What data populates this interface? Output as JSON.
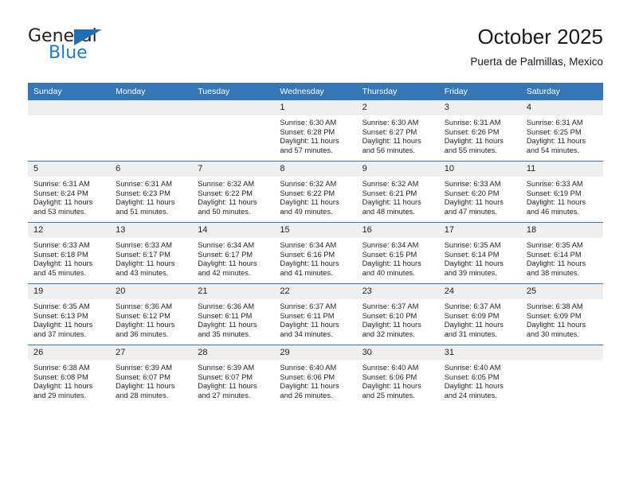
{
  "brand": {
    "name_top": "General",
    "name_bottom": "Blue",
    "accent_color": "#1f7ac4",
    "triangle_color": "#1f6fb5"
  },
  "header": {
    "title": "October 2025",
    "subtitle": "Puerta de Palmillas, Mexico"
  },
  "theme": {
    "header_bg": "#3576b5",
    "header_text": "#ffffff",
    "daynum_bg": "#efefef",
    "row_divider": "#3576b5",
    "body_text": "#231f20"
  },
  "weekdays": [
    "Sunday",
    "Monday",
    "Tuesday",
    "Wednesday",
    "Thursday",
    "Friday",
    "Saturday"
  ],
  "weeks": [
    [
      {
        "day": "",
        "empty": true,
        "sunrise": "",
        "sunset": "",
        "daylight1": "",
        "daylight2": ""
      },
      {
        "day": "",
        "empty": true,
        "sunrise": "",
        "sunset": "",
        "daylight1": "",
        "daylight2": ""
      },
      {
        "day": "",
        "empty": true,
        "sunrise": "",
        "sunset": "",
        "daylight1": "",
        "daylight2": ""
      },
      {
        "day": "1",
        "sunrise": "Sunrise: 6:30 AM",
        "sunset": "Sunset: 6:28 PM",
        "daylight1": "Daylight: 11 hours",
        "daylight2": "and 57 minutes."
      },
      {
        "day": "2",
        "sunrise": "Sunrise: 6:30 AM",
        "sunset": "Sunset: 6:27 PM",
        "daylight1": "Daylight: 11 hours",
        "daylight2": "and 56 minutes."
      },
      {
        "day": "3",
        "sunrise": "Sunrise: 6:31 AM",
        "sunset": "Sunset: 6:26 PM",
        "daylight1": "Daylight: 11 hours",
        "daylight2": "and 55 minutes."
      },
      {
        "day": "4",
        "sunrise": "Sunrise: 6:31 AM",
        "sunset": "Sunset: 6:25 PM",
        "daylight1": "Daylight: 11 hours",
        "daylight2": "and 54 minutes."
      }
    ],
    [
      {
        "day": "5",
        "sunrise": "Sunrise: 6:31 AM",
        "sunset": "Sunset: 6:24 PM",
        "daylight1": "Daylight: 11 hours",
        "daylight2": "and 53 minutes."
      },
      {
        "day": "6",
        "sunrise": "Sunrise: 6:31 AM",
        "sunset": "Sunset: 6:23 PM",
        "daylight1": "Daylight: 11 hours",
        "daylight2": "and 51 minutes."
      },
      {
        "day": "7",
        "sunrise": "Sunrise: 6:32 AM",
        "sunset": "Sunset: 6:22 PM",
        "daylight1": "Daylight: 11 hours",
        "daylight2": "and 50 minutes."
      },
      {
        "day": "8",
        "sunrise": "Sunrise: 6:32 AM",
        "sunset": "Sunset: 6:22 PM",
        "daylight1": "Daylight: 11 hours",
        "daylight2": "and 49 minutes."
      },
      {
        "day": "9",
        "sunrise": "Sunrise: 6:32 AM",
        "sunset": "Sunset: 6:21 PM",
        "daylight1": "Daylight: 11 hours",
        "daylight2": "and 48 minutes."
      },
      {
        "day": "10",
        "sunrise": "Sunrise: 6:33 AM",
        "sunset": "Sunset: 6:20 PM",
        "daylight1": "Daylight: 11 hours",
        "daylight2": "and 47 minutes."
      },
      {
        "day": "11",
        "sunrise": "Sunrise: 6:33 AM",
        "sunset": "Sunset: 6:19 PM",
        "daylight1": "Daylight: 11 hours",
        "daylight2": "and 46 minutes."
      }
    ],
    [
      {
        "day": "12",
        "sunrise": "Sunrise: 6:33 AM",
        "sunset": "Sunset: 6:18 PM",
        "daylight1": "Daylight: 11 hours",
        "daylight2": "and 45 minutes."
      },
      {
        "day": "13",
        "sunrise": "Sunrise: 6:33 AM",
        "sunset": "Sunset: 6:17 PM",
        "daylight1": "Daylight: 11 hours",
        "daylight2": "and 43 minutes."
      },
      {
        "day": "14",
        "sunrise": "Sunrise: 6:34 AM",
        "sunset": "Sunset: 6:17 PM",
        "daylight1": "Daylight: 11 hours",
        "daylight2": "and 42 minutes."
      },
      {
        "day": "15",
        "sunrise": "Sunrise: 6:34 AM",
        "sunset": "Sunset: 6:16 PM",
        "daylight1": "Daylight: 11 hours",
        "daylight2": "and 41 minutes."
      },
      {
        "day": "16",
        "sunrise": "Sunrise: 6:34 AM",
        "sunset": "Sunset: 6:15 PM",
        "daylight1": "Daylight: 11 hours",
        "daylight2": "and 40 minutes."
      },
      {
        "day": "17",
        "sunrise": "Sunrise: 6:35 AM",
        "sunset": "Sunset: 6:14 PM",
        "daylight1": "Daylight: 11 hours",
        "daylight2": "and 39 minutes."
      },
      {
        "day": "18",
        "sunrise": "Sunrise: 6:35 AM",
        "sunset": "Sunset: 6:14 PM",
        "daylight1": "Daylight: 11 hours",
        "daylight2": "and 38 minutes."
      }
    ],
    [
      {
        "day": "19",
        "sunrise": "Sunrise: 6:35 AM",
        "sunset": "Sunset: 6:13 PM",
        "daylight1": "Daylight: 11 hours",
        "daylight2": "and 37 minutes."
      },
      {
        "day": "20",
        "sunrise": "Sunrise: 6:36 AM",
        "sunset": "Sunset: 6:12 PM",
        "daylight1": "Daylight: 11 hours",
        "daylight2": "and 36 minutes."
      },
      {
        "day": "21",
        "sunrise": "Sunrise: 6:36 AM",
        "sunset": "Sunset: 6:11 PM",
        "daylight1": "Daylight: 11 hours",
        "daylight2": "and 35 minutes."
      },
      {
        "day": "22",
        "sunrise": "Sunrise: 6:37 AM",
        "sunset": "Sunset: 6:11 PM",
        "daylight1": "Daylight: 11 hours",
        "daylight2": "and 34 minutes."
      },
      {
        "day": "23",
        "sunrise": "Sunrise: 6:37 AM",
        "sunset": "Sunset: 6:10 PM",
        "daylight1": "Daylight: 11 hours",
        "daylight2": "and 32 minutes."
      },
      {
        "day": "24",
        "sunrise": "Sunrise: 6:37 AM",
        "sunset": "Sunset: 6:09 PM",
        "daylight1": "Daylight: 11 hours",
        "daylight2": "and 31 minutes."
      },
      {
        "day": "25",
        "sunrise": "Sunrise: 6:38 AM",
        "sunset": "Sunset: 6:09 PM",
        "daylight1": "Daylight: 11 hours",
        "daylight2": "and 30 minutes."
      }
    ],
    [
      {
        "day": "26",
        "sunrise": "Sunrise: 6:38 AM",
        "sunset": "Sunset: 6:08 PM",
        "daylight1": "Daylight: 11 hours",
        "daylight2": "and 29 minutes."
      },
      {
        "day": "27",
        "sunrise": "Sunrise: 6:39 AM",
        "sunset": "Sunset: 6:07 PM",
        "daylight1": "Daylight: 11 hours",
        "daylight2": "and 28 minutes."
      },
      {
        "day": "28",
        "sunrise": "Sunrise: 6:39 AM",
        "sunset": "Sunset: 6:07 PM",
        "daylight1": "Daylight: 11 hours",
        "daylight2": "and 27 minutes."
      },
      {
        "day": "29",
        "sunrise": "Sunrise: 6:40 AM",
        "sunset": "Sunset: 6:06 PM",
        "daylight1": "Daylight: 11 hours",
        "daylight2": "and 26 minutes."
      },
      {
        "day": "30",
        "sunrise": "Sunrise: 6:40 AM",
        "sunset": "Sunset: 6:06 PM",
        "daylight1": "Daylight: 11 hours",
        "daylight2": "and 25 minutes."
      },
      {
        "day": "31",
        "sunrise": "Sunrise: 6:40 AM",
        "sunset": "Sunset: 6:05 PM",
        "daylight1": "Daylight: 11 hours",
        "daylight2": "and 24 minutes."
      },
      {
        "day": "",
        "empty": true,
        "sunrise": "",
        "sunset": "",
        "daylight1": "",
        "daylight2": ""
      }
    ]
  ]
}
